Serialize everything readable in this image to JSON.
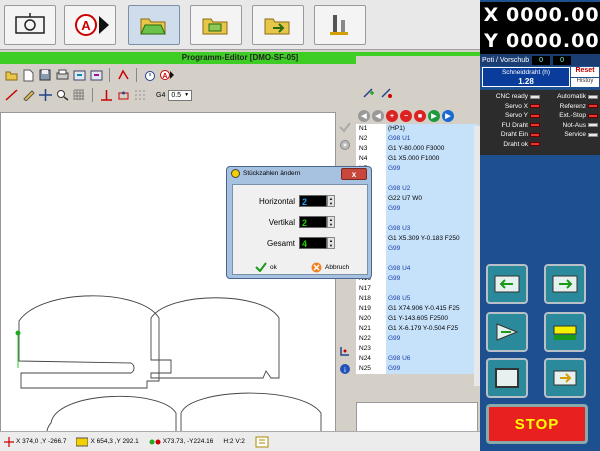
{
  "colors": {
    "title_bar": "#3ecd25",
    "cnc_panel": "#1e4f8e",
    "nc_code_bg": "#c6e2fb",
    "nc_code_blue": "#1b3fa6",
    "stop": "#e82020",
    "dialog": "#a7c2e0",
    "led_on": "#e2382d",
    "led_off": "#e8e8e8"
  },
  "top_toolbar": {
    "buttons": [
      {
        "name": "machine-view-icon",
        "selected": false
      },
      {
        "name": "auto-mode-icon",
        "selected": false
      },
      {
        "name": "open-folder-icon",
        "selected": true
      },
      {
        "name": "save-folder-icon",
        "selected": false
      },
      {
        "name": "export-folder-icon",
        "selected": false
      },
      {
        "name": "tools-icon",
        "selected": false
      }
    ]
  },
  "editor": {
    "title": "Programm-Editor [DMO-SF-05]",
    "g4_label": "G4",
    "g4_value": "0.5"
  },
  "nc_list": {
    "lines": [
      {
        "n": "N1",
        "code": "(HP1)"
      },
      {
        "n": "N2",
        "code": "G98 U1"
      },
      {
        "n": "N3",
        "code": "G1 Y-80.000 F3000"
      },
      {
        "n": "N4",
        "code": "G1 X5.000 F1000"
      },
      {
        "n": "N5",
        "code": "G99"
      },
      {
        "n": "N6",
        "code": ""
      },
      {
        "n": "N7",
        "code": "G98 U2"
      },
      {
        "n": "N8",
        "code": "G22 U7 W0"
      },
      {
        "n": "N9",
        "code": "G99"
      },
      {
        "n": "N10",
        "code": ""
      },
      {
        "n": "N11",
        "code": "G98 U3"
      },
      {
        "n": "N12",
        "code": "G1 X5.309 Y-0.183 F250"
      },
      {
        "n": "N13",
        "code": "G99"
      },
      {
        "n": "N14",
        "code": ""
      },
      {
        "n": "N15",
        "code": "G98 U4"
      },
      {
        "n": "N16",
        "code": "G99"
      },
      {
        "n": "N17",
        "code": ""
      },
      {
        "n": "N18",
        "code": "G98 U5"
      },
      {
        "n": "N19",
        "code": "G1 X74.906 Y-0.415 F25"
      },
      {
        "n": "N20",
        "code": "G1 Y-143.605 F2500"
      },
      {
        "n": "N21",
        "code": "G1 X-6.179 Y-0.504 F25"
      },
      {
        "n": "N22",
        "code": "G99"
      },
      {
        "n": "N23",
        "code": ""
      },
      {
        "n": "N24",
        "code": "G98 U6"
      },
      {
        "n": "N25",
        "code": "G99"
      }
    ]
  },
  "dialog": {
    "title": "Stückzahlen ändern",
    "close": "x",
    "horizontal_label": "Horizontal",
    "horizontal_value": "2",
    "vertikal_label": "Vertikal",
    "vertikal_value": "2",
    "gesamt_label": "Gesamt",
    "gesamt_value": "4",
    "ok_label": "ok",
    "cancel_label": "Abbruch"
  },
  "status_bar": {
    "cursor": "X 374,0 ,Y -266.7",
    "pos2": "X 654,3 ,Y 292.1",
    "pos3": "X73.73, -Y224.16",
    "hv": "H:2 V:2"
  },
  "cnc": {
    "x_label": "X",
    "x_value": "0000.00",
    "y_label": "Y",
    "y_value": "0000.00",
    "poti_label": "Poti / Vorschub",
    "poti_value": "0",
    "vorschub_value": "0",
    "schneid_label": "Schneiddraht (h)",
    "schneid_value": "1.28",
    "reset_label": "Reset",
    "history_label": "Histoy",
    "status_left": [
      {
        "label": "CNC ready",
        "on": false
      },
      {
        "label": "Servo X",
        "on": true
      },
      {
        "label": "Servo Y",
        "on": true
      },
      {
        "label": "FU Draht",
        "on": true
      },
      {
        "label": "Draht Ein",
        "on": true
      },
      {
        "label": "Draht ok",
        "on": true
      }
    ],
    "status_right": [
      {
        "label": "Automatik",
        "on": false
      },
      {
        "label": "Referenz",
        "on": true
      },
      {
        "label": "Ext.-Stop",
        "on": true
      },
      {
        "label": "Not-Aus",
        "on": false
      },
      {
        "label": "Service",
        "on": false
      }
    ],
    "stop_label": "STOP"
  }
}
